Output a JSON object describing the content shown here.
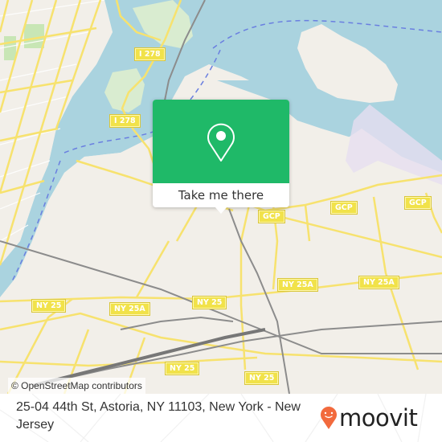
{
  "map": {
    "shields": [
      {
        "label": "I 278",
        "kind": "interstate"
      },
      {
        "label": "I 278",
        "kind": "interstate"
      },
      {
        "label": "GCP",
        "kind": "parkway"
      },
      {
        "label": "GCP",
        "kind": "parkway"
      },
      {
        "label": "GCP",
        "kind": "parkway"
      },
      {
        "label": "NY 25",
        "kind": "state-route"
      },
      {
        "label": "NY 25A",
        "kind": "state-route"
      },
      {
        "label": "NY 25A",
        "kind": "state-route"
      },
      {
        "label": "NY 25A",
        "kind": "state-route"
      },
      {
        "label": "NY 25",
        "kind": "state-route"
      },
      {
        "label": "NY 25",
        "kind": "state-route"
      },
      {
        "label": "NY 25",
        "kind": "state-route"
      }
    ],
    "colors": {
      "land": "#f2efe9",
      "water": "#aad3df",
      "park": "#c8e6b5",
      "major_road": "#f7e26e",
      "rail": "#8c8c8c",
      "ferry": "#6a7fe0",
      "airport": "#e6dff0"
    }
  },
  "popup": {
    "icon": "map-pin-icon",
    "cta_label": "Take me there",
    "color": "#1fb968"
  },
  "attribution": "© OpenStreetMap contributors",
  "footer": {
    "address": "25-04 44th St, Astoria, NY 11103, New York - New Jersey",
    "logo_text": "moovit",
    "logo_icon": "moovit-pin-icon",
    "logo_color": "#f26a3d"
  }
}
